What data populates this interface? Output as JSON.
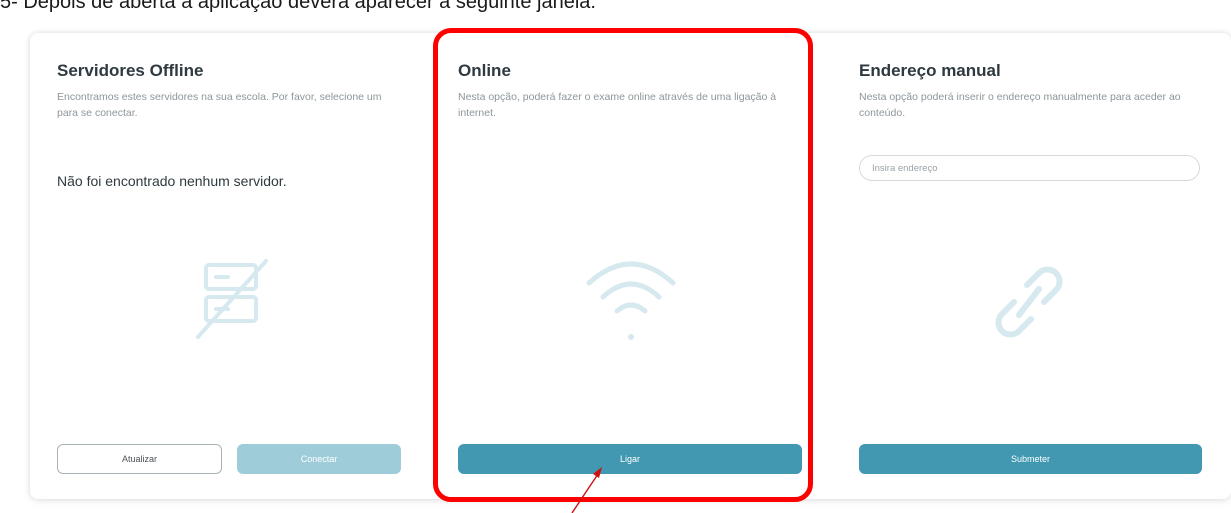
{
  "caption": "5- Depois de aberta a aplicação deverá aparecer a seguinte janela:",
  "offline": {
    "title": "Servidores Offline",
    "description": "Encontramos estes servidores na sua escola. Por favor, selecione um para se conectar.",
    "empty_message": "Não foi encontrado nenhum servidor.",
    "icon": "server-off-icon",
    "refresh_label": "Atualizar",
    "connect_label": "Conectar"
  },
  "online": {
    "title": "Online",
    "description": "Nesta opção, poderá fazer o exame online através de uma ligação à internet.",
    "icon": "wifi-icon",
    "connect_label": "Ligar"
  },
  "manual": {
    "title": "Endereço manual",
    "description": "Nesta opção poderá inserir o endereço manualmente para aceder ao conteúdo.",
    "input_placeholder": "Insira endereço",
    "input_value": "",
    "icon": "link-icon",
    "submit_label": "Submeter"
  },
  "annotation": {
    "highlight_color": "#ff0000",
    "target": "Ligar"
  },
  "colors": {
    "primary": "#4198b0",
    "primary_disabled": "#9ecdd9",
    "icon_tint": "#d6e9ef",
    "title": "#2e3a40",
    "muted": "#8d969b"
  }
}
